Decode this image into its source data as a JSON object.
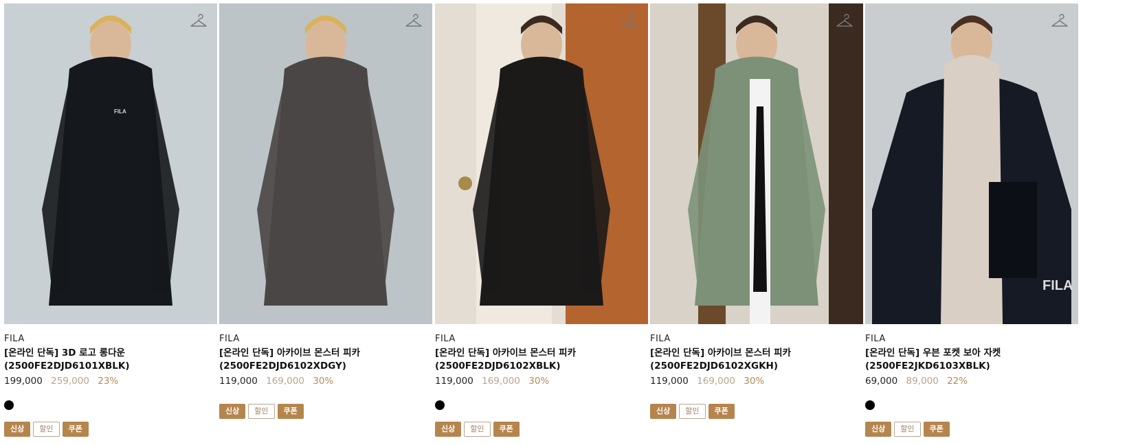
{
  "products": [
    {
      "brand": "FILA",
      "name_line1": "[온라인 단독] 3D 로고 롱다운",
      "name_line2": "(2500FE2DJD6101XBLK)",
      "price": "199,000",
      "original_price": "259,000",
      "discount": "23%",
      "has_swatch": true,
      "swatch_color": "#000000",
      "badges": [
        "신상",
        "할인",
        "쿠폰"
      ],
      "bg": "#c9d0d3",
      "coat": "#15181c"
    },
    {
      "brand": "FILA",
      "name_line1": "[온라인 단독] 아카이브 몬스터 피카",
      "name_line2": "(2500FE2DJD6102XDGY)",
      "price": "119,000",
      "original_price": "169,000",
      "discount": "30%",
      "has_swatch": false,
      "badges": [
        "신상",
        "할인",
        "쿠폰"
      ],
      "bg": "#bcc4c7",
      "coat": "#4a4645"
    },
    {
      "brand": "FILA",
      "name_line1": "[온라인 단독] 아카이브 몬스터 피카",
      "name_line2": "(2500FE2DJD6102XBLK)",
      "price": "119,000",
      "original_price": "169,000",
      "discount": "30%",
      "has_swatch": true,
      "swatch_color": "#000000",
      "badges": [
        "신상",
        "할인",
        "쿠폰"
      ],
      "bg": "#e3ddd3",
      "coat": "#1b1a19"
    },
    {
      "brand": "FILA",
      "name_line1": "[온라인 단독] 아카이브 몬스터 피카",
      "name_line2": "(2500FE2DJD6102XGKH)",
      "price": "119,000",
      "original_price": "169,000",
      "discount": "30%",
      "has_swatch": false,
      "badges": [
        "신상",
        "할인",
        "쿠폰"
      ],
      "bg": "#d8d2c8",
      "coat": "#7c9178"
    },
    {
      "brand": "FILA",
      "name_line1": "[온라인 단독] 우븐 포켓 보아 자켓",
      "name_line2": "(2500FE2JKD6103XBLK)",
      "price": "69,000",
      "original_price": "89,000",
      "discount": "22%",
      "has_swatch": true,
      "swatch_color": "#000000",
      "badges": [
        "신상",
        "할인",
        "쿠폰"
      ],
      "bg": "#c9cdcf",
      "coat": "#161a24",
      "logo_text": "FILA"
    }
  ],
  "icons": {
    "wishlist": "hanger-icon"
  },
  "colors": {
    "badge_fill": "#b5854e",
    "original_price": "#b9a48c",
    "discount": "#b48a57"
  }
}
